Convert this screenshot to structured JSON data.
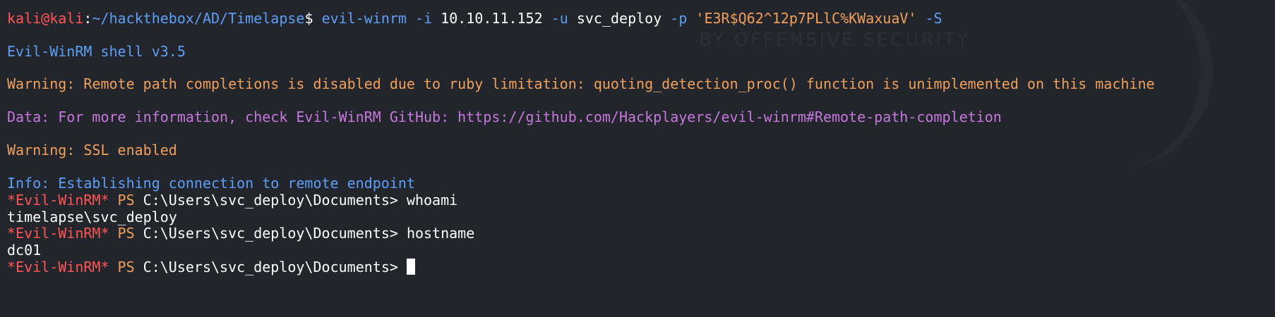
{
  "terminal": {
    "watermark": "BY OFFENSIVE SECURITY",
    "prompt": {
      "user_host_a": "kali",
      "at": "@",
      "user_host_b": "kali",
      "colon": ":",
      "path": "~/hackthebox/AD/Timelapse",
      "dollar": "$ ",
      "command": {
        "program": "evil-winrm",
        "flag_i": " -i",
        "ip": " 10.10.11.152",
        "flag_u": " -u",
        "user": " svc_deploy",
        "flag_p": " -p",
        "password": " 'E3R$Q62^12p7PLlC%KWaxuaV'",
        "flag_s": " -S"
      }
    },
    "output": {
      "shell_version": "Evil-WinRM shell v3.5",
      "warning_completion": "Warning: Remote path completions is disabled due to ruby limitation: quoting_detection_proc() function is unimplemented on this machine",
      "data_info": "Data: For more information, check Evil-WinRM GitHub: https://github.com/Hackplayers/evil-winrm#Remote-path-completion",
      "warning_ssl": "Warning: SSL enabled",
      "info_connect": "Info: Establishing connection to remote endpoint"
    },
    "session": {
      "ps_tag": "*Evil-WinRM*",
      "ps_label": " PS",
      "ps_path": " C:\\Users\\svc_deploy\\Documents> ",
      "cmd_1": "whoami",
      "result_1": "timelapse\\svc_deploy",
      "cmd_2": "hostname",
      "result_2": "dc01"
    }
  },
  "colors": {
    "background": "#22252b",
    "prompt_red": "#ff5555",
    "path_blue": "#5e9ff6",
    "warning_orange": "#f0a05a",
    "data_purple": "#c678dd",
    "text_white": "#ffffff"
  }
}
